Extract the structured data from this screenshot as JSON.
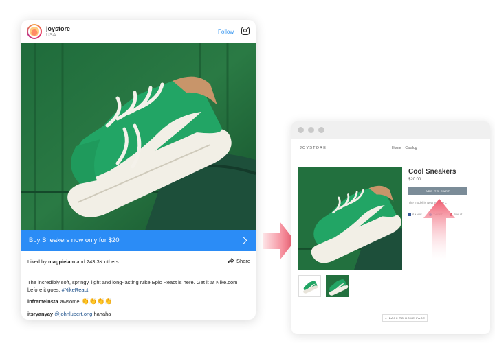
{
  "instagram": {
    "username": "joystore",
    "location": "USA",
    "follow_label": "Follow",
    "buy_bar_text": "Buy Sneakers now only for $20",
    "likes_prefix": "Liked by",
    "likes_user": "magpieiam",
    "likes_suffix": "and 243.3K others",
    "share_label": "Share",
    "caption": "The incredibly soft, springy, light and long-lasting Nike Epic React is here. Get it at Nike.com before it goes.",
    "hashtag": "#NikeReact",
    "comments": [
      {
        "user": "inframeinsta",
        "text": "awsome"
      },
      {
        "user": "itsryanyay",
        "mention": "@johnlubert.ong",
        "text": "hahaha"
      }
    ],
    "icons": [
      "instagram-icon",
      "share-arrow-icon",
      "chevron-right-icon",
      "clap-emoji"
    ]
  },
  "store": {
    "logo": "JOYSTORE",
    "nav": [
      "Home",
      "Catalog"
    ],
    "product_title": "Cool Sneakers",
    "price": "$20.00",
    "add_to_cart": "ADD TO CART",
    "description": "The model is wearing size L",
    "share_buttons": [
      "SHARE",
      "TWEET",
      "PIN IT"
    ],
    "back_home": "← BACK TO HOME PAGE"
  },
  "colors": {
    "instagram_blue": "#2b8cf6",
    "follow_blue": "#3897f0",
    "cart_button": "#7b8c98",
    "arrow_red": "#f05a6e",
    "shoe_green": "#22a565"
  }
}
